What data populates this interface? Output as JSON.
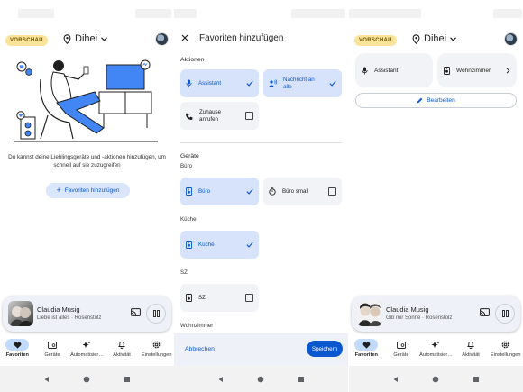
{
  "screen1": {
    "badge": "VORSCHAU",
    "home_name": "Dihei",
    "empty_text": "Du kannst deine Lieblingsgeräte und -aktionen hinzufügen, um schnell auf sie zuzugreifen",
    "add_favorites_label": "Favoriten hinzufügen",
    "player": {
      "title": "Claudia Musig",
      "subtitle": "Liebe ist alles · Rosenstolz"
    }
  },
  "screen2": {
    "title": "Favoriten hinzufügen",
    "actions_heading": "Aktionen",
    "actions": [
      {
        "label": "Assistant",
        "selected": true,
        "icon": "mic-icon"
      },
      {
        "label": "Nachricht an alle",
        "selected": true,
        "icon": "broadcast-icon"
      },
      {
        "label": "Zuhause anrufen",
        "selected": false,
        "icon": "phone-icon"
      }
    ],
    "devices_heading": "Geräte",
    "rooms": [
      {
        "name": "Büro",
        "devices": [
          {
            "label": "Büro",
            "selected": true,
            "icon": "speaker-icon"
          },
          {
            "label": "Büro small",
            "selected": false,
            "icon": "timer-icon"
          }
        ]
      },
      {
        "name": "Küche",
        "devices": [
          {
            "label": "Küche",
            "selected": true,
            "icon": "speaker-icon"
          }
        ]
      },
      {
        "name": "SZ",
        "devices": [
          {
            "label": "SZ",
            "selected": false,
            "icon": "speaker-icon"
          }
        ]
      },
      {
        "name": "Wohnzimmer",
        "devices": []
      }
    ],
    "cancel_label": "Abbrechen",
    "save_label": "Speichern"
  },
  "screen3": {
    "badge": "VORSCHAU",
    "home_name": "Dihei",
    "favorites": [
      {
        "label": "Assistant",
        "icon": "mic-icon"
      },
      {
        "label": "Wohnzimmer",
        "icon": "speaker-icon"
      }
    ],
    "edit_label": "Bearbeiten",
    "player": {
      "title": "Claudia Musig",
      "subtitle": "Gib mir Sonne · Rosenstolz"
    }
  },
  "nav": [
    "Favoriten",
    "Geräte",
    "Automatisier…",
    "Aktivität",
    "Einstellungen"
  ],
  "colors": {
    "accent": "#0b57d0",
    "selected_tile": "#d6e3fb",
    "badge": "#fbe39a",
    "nav_active": "#c2dbfc"
  }
}
